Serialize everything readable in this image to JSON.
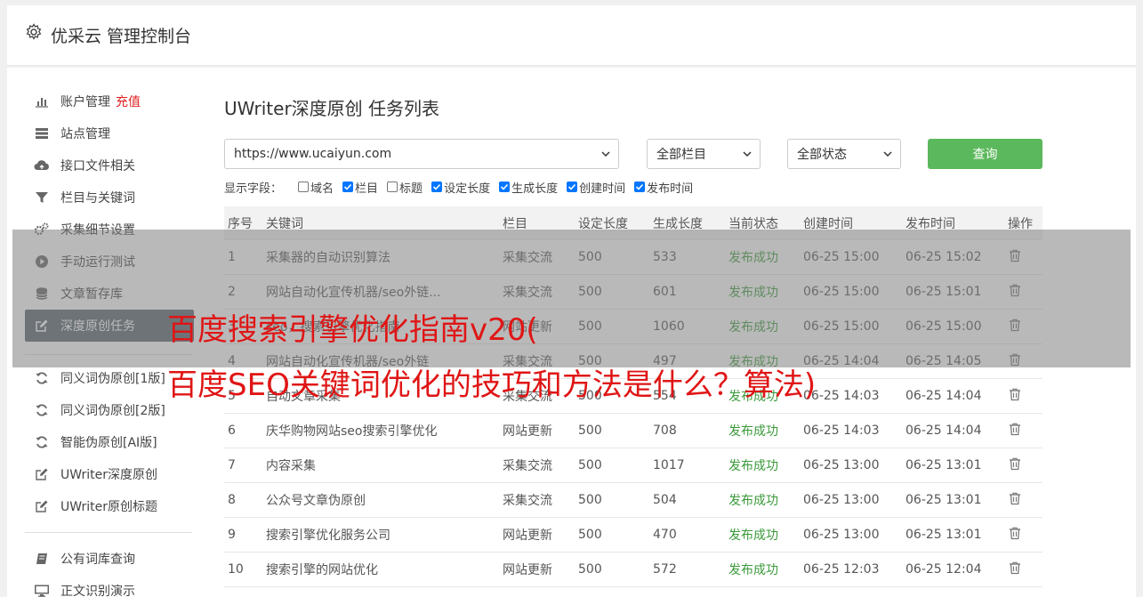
{
  "header": {
    "title": "优采云 管理控制台",
    "icon": "gear-icon"
  },
  "sidebar": {
    "items": [
      {
        "label": "账户管理",
        "badge": "充值",
        "icon": "bar-chart-icon",
        "active": false
      },
      {
        "label": "站点管理",
        "icon": "server-icon",
        "active": false
      },
      {
        "label": "接口文件相关",
        "icon": "cloud-upload-icon",
        "active": false
      },
      {
        "label": "栏目与关键词",
        "icon": "filter-icon",
        "active": false
      },
      {
        "label": "采集细节设置",
        "icon": "cogs-icon",
        "active": false
      },
      {
        "label": "手动运行测试",
        "icon": "play-icon",
        "active": false
      },
      {
        "label": "文章暂存库",
        "icon": "database-icon",
        "active": false
      },
      {
        "label": "深度原创任务",
        "icon": "edit-icon",
        "active": true
      }
    ],
    "items2": [
      {
        "label": "同义词伪原创[1版]",
        "icon": "refresh-icon"
      },
      {
        "label": "同义词伪原创[2版]",
        "icon": "refresh-icon"
      },
      {
        "label": "智能伪原创[AI版]",
        "icon": "refresh-icon"
      },
      {
        "label": "UWriter深度原创",
        "icon": "edit-icon"
      },
      {
        "label": "UWriter原创标题",
        "icon": "edit-icon"
      }
    ],
    "items3": [
      {
        "label": "公有词库查询",
        "icon": "book-icon"
      },
      {
        "label": "正文识别演示",
        "icon": "monitor-icon"
      }
    ]
  },
  "main": {
    "title": "UWriter深度原创 任务列表",
    "site_select": "https://www.ucaiyun.com",
    "column_select": "全部栏目",
    "status_select": "全部状态",
    "query_label": "查询",
    "fields_label": "显示字段：",
    "fields": [
      {
        "label": "域名",
        "checked": false
      },
      {
        "label": "栏目",
        "checked": true
      },
      {
        "label": "标题",
        "checked": false
      },
      {
        "label": "设定长度",
        "checked": true
      },
      {
        "label": "生成长度",
        "checked": true
      },
      {
        "label": "创建时间",
        "checked": true
      },
      {
        "label": "发布时间",
        "checked": true
      }
    ]
  },
  "table": {
    "headers": [
      "序号",
      "关键词",
      "栏目",
      "设定长度",
      "生成长度",
      "当前状态",
      "创建时间",
      "发布时间",
      "操作"
    ],
    "rows": [
      [
        "1",
        "采集器的自动识别算法",
        "采集交流",
        "500",
        "533",
        "发布成功",
        "06-25 15:00",
        "06-25 15:02"
      ],
      [
        "2",
        "网站自动化宣传机器/seo外链...",
        "采集交流",
        "500",
        "601",
        "发布成功",
        "06-25 15:00",
        "06-25 15:01"
      ],
      [
        "3",
        "seo，搜索引擎优化指南",
        "网站更新",
        "500",
        "1060",
        "发布成功",
        "06-25 15:00",
        "06-25 15:00"
      ],
      [
        "4",
        "网站自动化宣传机器/seo外链",
        "采集交流",
        "500",
        "497",
        "发布成功",
        "06-25 14:04",
        "06-25 14:05"
      ],
      [
        "5",
        "自动文章采集",
        "采集交流",
        "500",
        "554",
        "发布成功",
        "06-25 14:03",
        "06-25 14:04"
      ],
      [
        "6",
        "庆华购物网站seo搜索引擎优化",
        "网站更新",
        "500",
        "708",
        "发布成功",
        "06-25 14:03",
        "06-25 14:04"
      ],
      [
        "7",
        "内容采集",
        "采集交流",
        "500",
        "1017",
        "发布成功",
        "06-25 13:00",
        "06-25 13:01"
      ],
      [
        "8",
        "公众号文章伪原创",
        "采集交流",
        "500",
        "504",
        "发布成功",
        "06-25 13:00",
        "06-25 13:01"
      ],
      [
        "9",
        "搜索引擎优化服务公司",
        "网站更新",
        "500",
        "470",
        "发布成功",
        "06-25 13:00",
        "06-25 13:01"
      ],
      [
        "10",
        "搜索引擎的网站优化",
        "网站更新",
        "500",
        "572",
        "发布成功",
        "06-25 12:03",
        "06-25 12:04"
      ]
    ]
  },
  "overlay": {
    "line1": "百度搜索引擎优化指南v20(",
    "line2": "百度SEO关键词优化的技巧和方法是什么？算法)"
  },
  "colors": {
    "accent": "#5cb85c",
    "active_nav": "#5a6470",
    "headline": "#e01515",
    "success": "#3b9a3b"
  }
}
